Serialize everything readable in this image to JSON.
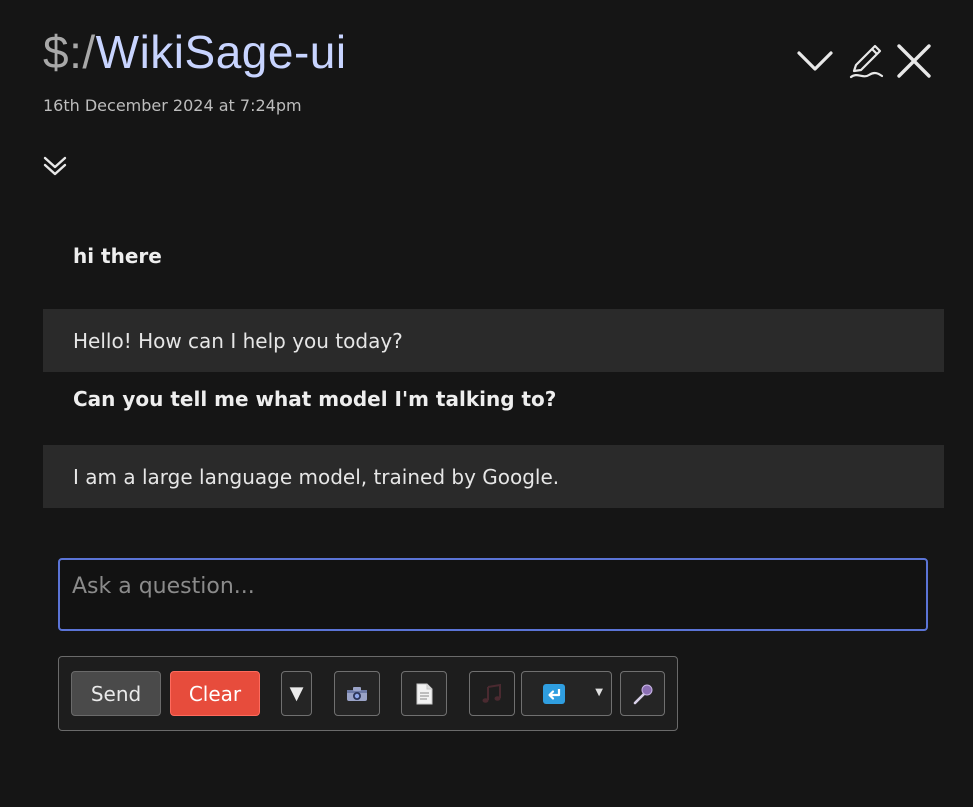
{
  "header": {
    "prompt": "$:/",
    "title": "WikiSage-ui",
    "timestamp": "16th December 2024 at 7:24pm"
  },
  "icons": {
    "collapse": "chevron-down-icon",
    "edit": "pencil-icon",
    "close": "close-icon",
    "expand": "double-chevron-down-icon",
    "camera": "camera-icon",
    "document": "document-icon",
    "music": "music-note-icon",
    "return": "return-arrow-icon",
    "mic": "microphone-icon"
  },
  "conversation": {
    "messages": [
      {
        "role": "user",
        "text": "hi there"
      },
      {
        "role": "assistant",
        "text": "Hello! How can I help you today?"
      },
      {
        "role": "user",
        "text": "Can you tell me what model I'm talking to?"
      },
      {
        "role": "assistant",
        "text": "I am a large language model, trained by Google."
      }
    ]
  },
  "input": {
    "placeholder": "Ask a question...",
    "value": ""
  },
  "toolbar": {
    "send_label": "Send",
    "clear_label": "Clear",
    "mode_label": "▼"
  },
  "colors": {
    "background": "#151515",
    "accent_border": "#5b74d6",
    "clear_button": "#e74c3c",
    "assistant_bubble": "#2a2a2a",
    "title_color": "#c8d4ff"
  }
}
